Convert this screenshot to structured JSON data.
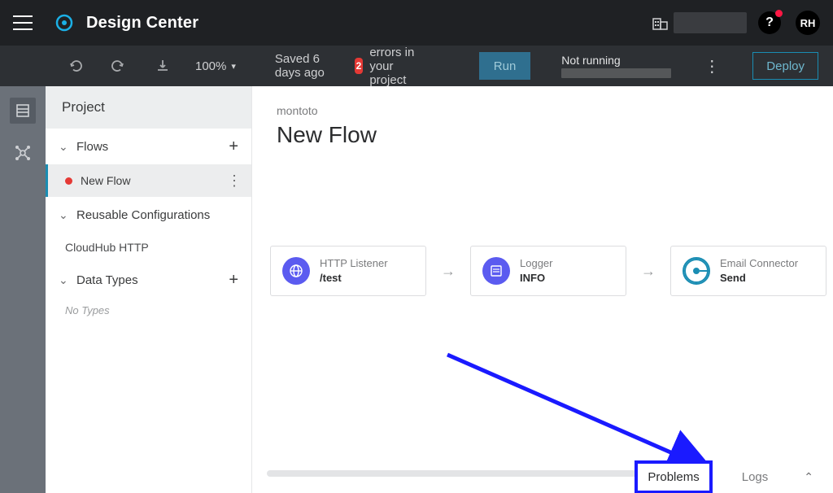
{
  "header": {
    "app_title": "Design Center",
    "help": "?",
    "avatar_initials": "RH"
  },
  "toolbar": {
    "zoom": "100%",
    "saved_text": "Saved 6 days ago",
    "error_count": "2",
    "errors_text": "errors in your project",
    "run_label": "Run",
    "status_text": "Not running",
    "deploy_label": "Deploy"
  },
  "sidebar": {
    "title": "Project",
    "flows_label": "Flows",
    "flow_items": [
      "New Flow"
    ],
    "reusable_label": "Reusable Configurations",
    "reusable_items": [
      "CloudHub HTTP"
    ],
    "datatypes_label": "Data Types",
    "no_types": "No Types"
  },
  "canvas": {
    "breadcrumb": "montoto",
    "title": "New Flow",
    "cards": [
      {
        "title": "HTTP Listener",
        "subtitle": "/test"
      },
      {
        "title": "Logger",
        "subtitle": "INFO"
      },
      {
        "title": "Email Connector",
        "subtitle": "Send"
      }
    ]
  },
  "bottom": {
    "problems": "Problems",
    "logs": "Logs"
  }
}
